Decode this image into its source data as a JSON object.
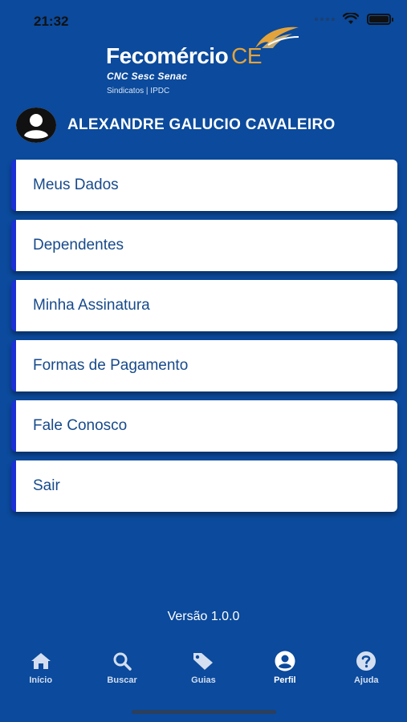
{
  "status_bar": {
    "time": "21:32",
    "battery_level": 1.0,
    "icons": [
      "signal-dots-icon",
      "wifi-icon",
      "battery-icon"
    ]
  },
  "logo": {
    "main": "Fecomércio",
    "suffix": "CE",
    "sub": "CNC Sesc Senac",
    "sub2": "Sindicatos | IPDC"
  },
  "user": {
    "name": "ALEXANDRE GALUCIO CAVALEIRO",
    "avatar_icon": "user-circle-icon"
  },
  "menu": {
    "items": [
      {
        "label": "Meus Dados"
      },
      {
        "label": "Dependentes"
      },
      {
        "label": "Minha Assinatura"
      },
      {
        "label": "Formas de Pagamento"
      },
      {
        "label": "Fale Conosco"
      },
      {
        "label": "Sair"
      }
    ]
  },
  "version": "Versão 1.0.0",
  "tabs": [
    {
      "label": "Início",
      "icon": "home-icon",
      "active": false
    },
    {
      "label": "Buscar",
      "icon": "search-icon",
      "active": false
    },
    {
      "label": "Guias",
      "icon": "tag-icon",
      "active": false
    },
    {
      "label": "Perfil",
      "icon": "user-icon",
      "active": true
    },
    {
      "label": "Ajuda",
      "icon": "help-icon",
      "active": false
    }
  ],
  "colors": {
    "background": "#0b4a9c",
    "card": "#ffffff",
    "card_text": "#174a8b",
    "card_accent": "#1a2fd6",
    "logo_accent": "#e3a33b"
  }
}
